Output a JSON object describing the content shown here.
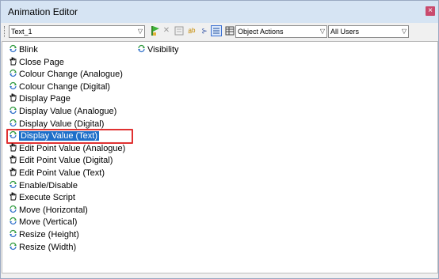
{
  "window": {
    "title": "Animation Editor",
    "close_glyph": "×"
  },
  "toolbar": {
    "object_select": "Text_1",
    "actions_select": "Object Actions",
    "users_select": "All Users",
    "icons": [
      "green-flag-icon",
      "delete-icon",
      "properties-icon",
      "text-ab-icon",
      "connector-icon",
      "list-view-icon",
      "grid-view-icon"
    ]
  },
  "list": {
    "selected_index": 7,
    "items": [
      {
        "label": "Blink",
        "icon": "animation-icon"
      },
      {
        "label": "Close Page",
        "icon": "hand-icon"
      },
      {
        "label": "Colour Change (Analogue)",
        "icon": "animation-icon"
      },
      {
        "label": "Colour Change (Digital)",
        "icon": "animation-icon"
      },
      {
        "label": "Display Page",
        "icon": "hand-icon"
      },
      {
        "label": "Display Value (Analogue)",
        "icon": "animation-icon"
      },
      {
        "label": "Display Value (Digital)",
        "icon": "animation-icon"
      },
      {
        "label": "Display Value (Text)",
        "icon": "animation-icon"
      },
      {
        "label": "Edit Point Value (Analogue)",
        "icon": "hand-icon"
      },
      {
        "label": "Edit Point Value (Digital)",
        "icon": "hand-icon"
      },
      {
        "label": "Edit Point Value (Text)",
        "icon": "hand-icon"
      },
      {
        "label": "Enable/Disable",
        "icon": "animation-icon"
      },
      {
        "label": "Execute Script",
        "icon": "hand-icon"
      },
      {
        "label": "Move (Horizontal)",
        "icon": "animation-icon"
      },
      {
        "label": "Move (Vertical)",
        "icon": "animation-icon"
      },
      {
        "label": "Resize (Height)",
        "icon": "animation-icon"
      },
      {
        "label": "Resize (Width)",
        "icon": "animation-icon"
      },
      {
        "label": "Visibility",
        "icon": "animation-icon"
      }
    ]
  },
  "colors": {
    "selection": "#1e6fc9",
    "highlight": "#e03131",
    "titlebar": "#d6e4f3"
  }
}
